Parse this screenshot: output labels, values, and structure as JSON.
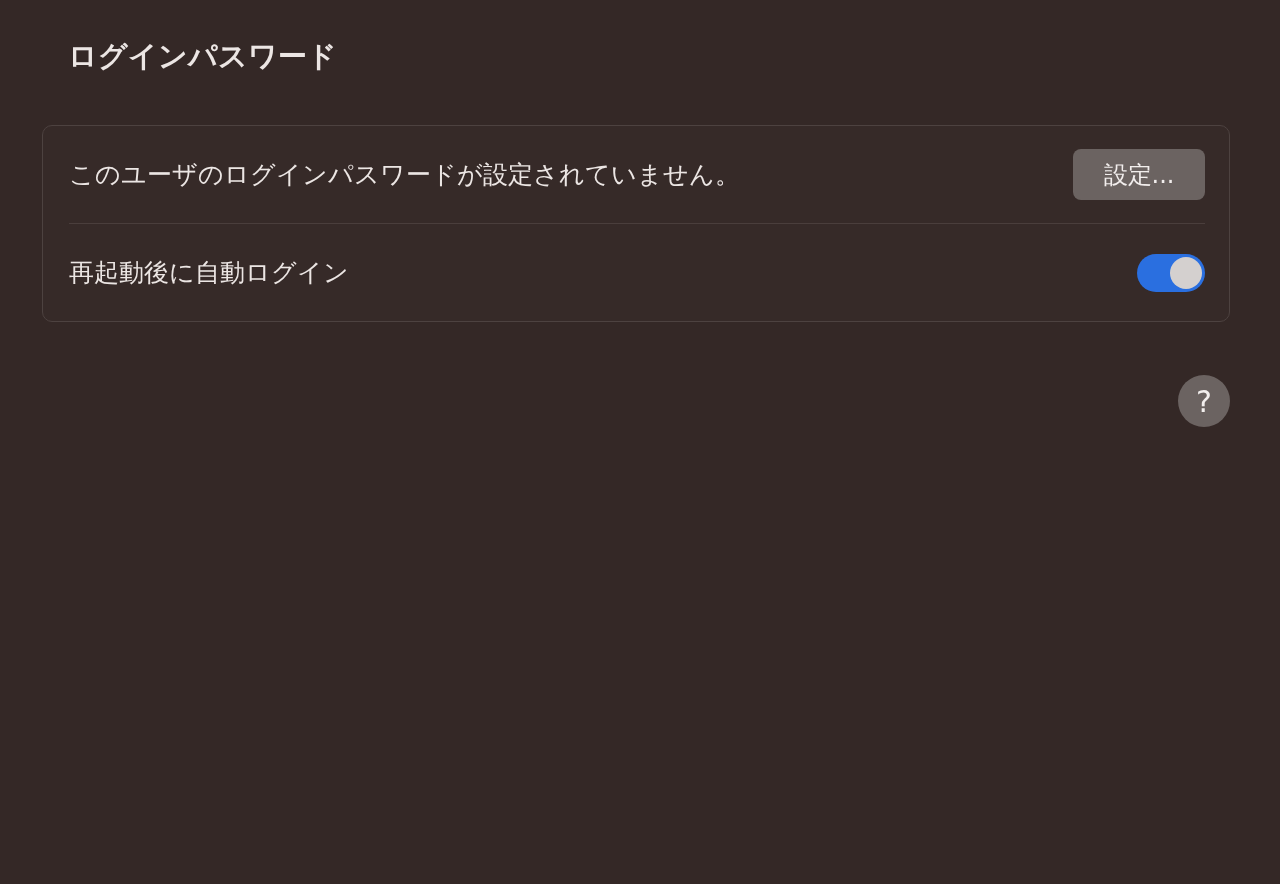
{
  "title": "ログインパスワード",
  "rows": [
    {
      "kind": "button",
      "label": "このユーザのログインパスワードが設定されていません。",
      "button": "設定..."
    },
    {
      "kind": "toggle",
      "label": "再起動後に自動ログイン",
      "on": true
    }
  ],
  "help": "?"
}
